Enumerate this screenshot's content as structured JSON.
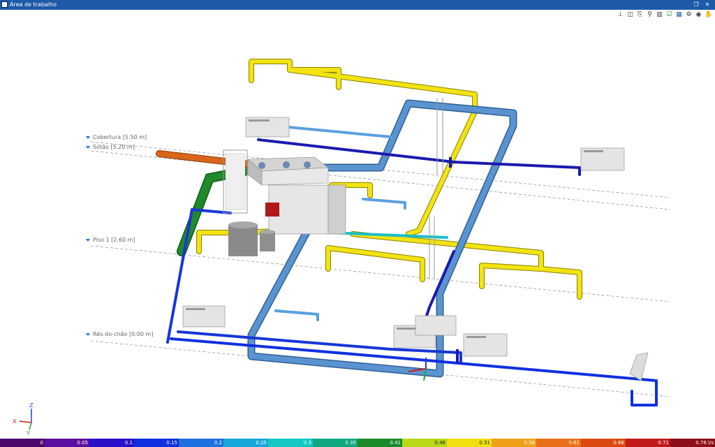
{
  "window": {
    "title": "Área de trabalho",
    "restore_glyph": "❐",
    "close_glyph": "✕"
  },
  "toolbar": {
    "icons": [
      "axes-icon",
      "cube-icon",
      "layers-icon",
      "view-icon",
      "panel-icon",
      "check-icon",
      "table-icon",
      "settings-icon",
      "eye-icon",
      "hand-icon"
    ]
  },
  "levels": [
    {
      "label": "Cobertura [5.50 m]"
    },
    {
      "label": "Sótão [5.20 m]"
    },
    {
      "label": "Piso 1 [2.60 m]"
    },
    {
      "label": "Rés-do-chão [0.00 m]"
    }
  ],
  "axes": {
    "z": "Z",
    "x": "X",
    "y": "Y",
    "z_color": "#1f3fcf",
    "x_color": "#d01515",
    "y_color": "#1aa82a"
  },
  "legend": {
    "unit_label": "0.76 l/s",
    "stops": [
      {
        "label": "0",
        "color": "#4b0a6b"
      },
      {
        "label": "0.05",
        "color": "#5a0fa0"
      },
      {
        "label": "0.1",
        "color": "#2a10c8"
      },
      {
        "label": "0.15",
        "color": "#1030e0"
      },
      {
        "label": "0.2",
        "color": "#1e6fe0"
      },
      {
        "label": "0.25",
        "color": "#16a8d8"
      },
      {
        "label": "0.3",
        "color": "#12c8c0"
      },
      {
        "label": "0.35",
        "color": "#10a880"
      },
      {
        "label": "0.41",
        "color": "#1a8a2a"
      },
      {
        "label": "0.46",
        "color": "#b8d818"
      },
      {
        "label": "0.51",
        "color": "#f0e010"
      },
      {
        "label": "0.56",
        "color": "#f0a018"
      },
      {
        "label": "0.61",
        "color": "#e87018"
      },
      {
        "label": "0.66",
        "color": "#d84a10"
      },
      {
        "label": "0.71",
        "color": "#c01a1a"
      },
      {
        "label": "0.76",
        "color": "#8a0f1a"
      }
    ]
  },
  "colors": {
    "pipe_yellow": "#f2e313",
    "pipe_lightblue": "#5aa0e0",
    "pipe_steel": "#4a7fb8",
    "pipe_blue": "#1836d8",
    "pipe_darkblue": "#1a1ab0",
    "pipe_green": "#1f8a2a",
    "pipe_orange": "#d8661a",
    "unit_grey": "#e4e4e4"
  }
}
